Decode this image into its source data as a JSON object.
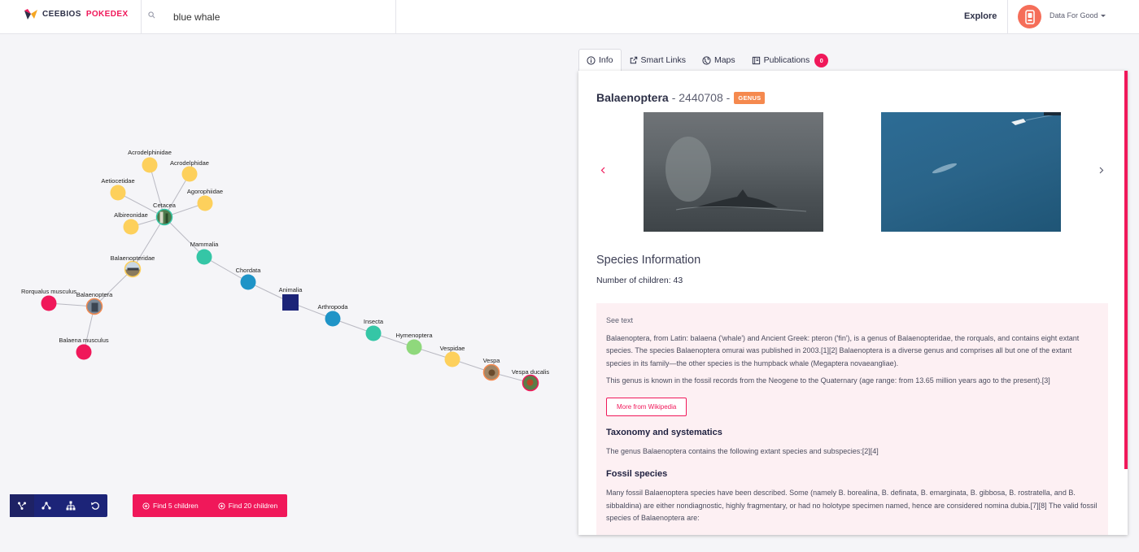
{
  "app": {
    "brand_part1": "CEEBIOS",
    "brand_part2": "POKEDEX"
  },
  "search": {
    "value": "blue whale",
    "placeholder": "Search"
  },
  "header": {
    "explore": "Explore",
    "user": "Data For Good"
  },
  "graph": {
    "nodes": [
      {
        "label": "Acrodelphinidae",
        "color": "#fdd05c"
      },
      {
        "label": "Acrodelphidae",
        "color": "#fdd05c"
      },
      {
        "label": "Aetiocetidae",
        "color": "#fdd05c"
      },
      {
        "label": "Agorophiidae",
        "color": "#fdd05c"
      },
      {
        "label": "Cetacea",
        "color": "image"
      },
      {
        "label": "Albireonidae",
        "color": "#fdd05c"
      },
      {
        "label": "Mammalia",
        "color": "#35c6a6"
      },
      {
        "label": "Balaenopteridae",
        "color": "image"
      },
      {
        "label": "Chordata",
        "color": "#1f94c7"
      },
      {
        "label": "Rorqualus musculus",
        "color": "#f0185a"
      },
      {
        "label": "Balaenoptera",
        "color": "image"
      },
      {
        "label": "Animalia",
        "color": "#1c2478"
      },
      {
        "label": "Arthropoda",
        "color": "#1f94c7"
      },
      {
        "label": "Insecta",
        "color": "#35c6a6"
      },
      {
        "label": "Balaena musculus",
        "color": "#f0185a"
      },
      {
        "label": "Hymenoptera",
        "color": "#8fd87c"
      },
      {
        "label": "Vespidae",
        "color": "#fdd05c"
      },
      {
        "label": "Vespa",
        "color": "image"
      },
      {
        "label": "Vespa ducalis",
        "color": "image"
      }
    ]
  },
  "controls": {
    "find5": "Find 5 children",
    "find20": "Find 20 children"
  },
  "tabs": [
    {
      "label": "Info"
    },
    {
      "label": "Smart Links"
    },
    {
      "label": "Maps"
    },
    {
      "label": "Publications",
      "count": "0"
    }
  ],
  "panel": {
    "title_name": "Balaenoptera",
    "title_rest": "- 2440708 -",
    "rank": "GENUS",
    "section_title": "Species Information",
    "children_count": "Number of children: 43",
    "see_text": "See text",
    "para1": "Balaenoptera, from Latin: balaena ('whale') and Ancient Greek: pteron ('fin'), is a genus of Balaenopteridae, the rorquals, and contains eight extant species. The species Balaenoptera omurai was published in 2003.[1][2] Balaenoptera is a diverse genus and comprises all but one of the extant species in its family—the other species is the humpback whale (Megaptera novaeangliae).",
    "para2": "This genus is known in the fossil records from the Neogene to the Quaternary (age range: from 13.65 million years ago to the present).[3]",
    "wiki_button": "More from Wikipedia",
    "h_taxonomy": "Taxonomy and systematics",
    "para3": "The genus Balaenoptera contains the following extant species and subspecies:[2][4]",
    "h_fossil": "Fossil species",
    "para4": "Many fossil Balaenoptera species have been described. Some (namely B. borealina, B. definata, B. emarginata, B. gibbosa, B. rostratella, and B. sibbaldina) are either nondiagnostic, highly fragmentary, or had no holotype specimen named, hence are considered nomina dubia.[7][8] The valid fossil species of Balaenoptera are:"
  },
  "colors": {
    "accent": "#f0185a",
    "navy": "#1c2478",
    "genus_badge": "#f5894e"
  }
}
